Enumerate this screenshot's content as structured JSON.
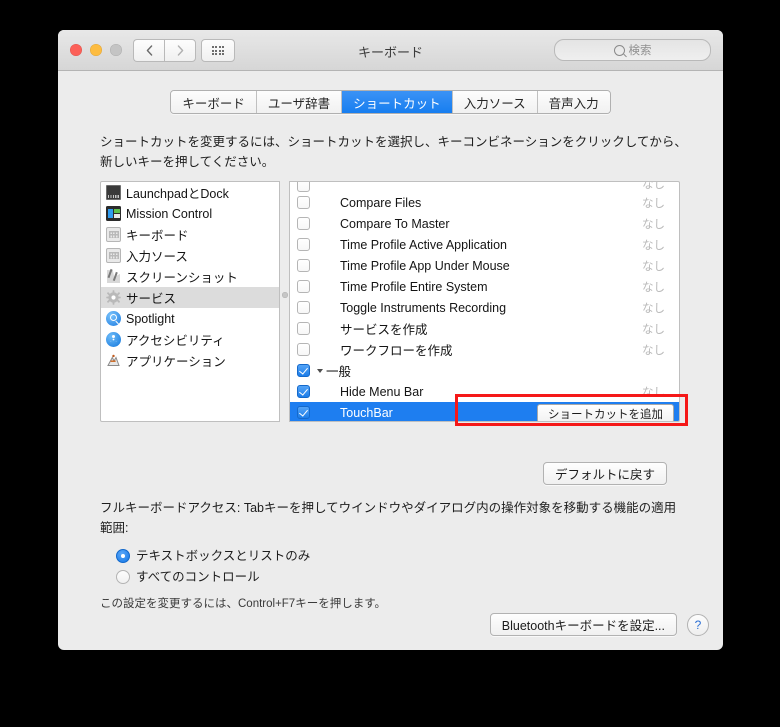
{
  "window": {
    "title": "キーボード",
    "traffic": {
      "close": "close-button",
      "minimize": "minimize-button",
      "zoom": "zoom-button"
    },
    "nav": {
      "back": "‹",
      "forward": "›"
    },
    "search": {
      "placeholder": "検索",
      "value": ""
    }
  },
  "tabs": [
    {
      "label": "キーボード",
      "active": false
    },
    {
      "label": "ユーザ辞書",
      "active": false
    },
    {
      "label": "ショートカット",
      "active": true
    },
    {
      "label": "入力ソース",
      "active": false
    },
    {
      "label": "音声入力",
      "active": false
    }
  ],
  "instruction": "ショートカットを変更するには、ショートカットを選択し、キーコンビネーションをクリックしてから、新しいキーを押してください。",
  "sidebar": {
    "items": [
      {
        "label": "LaunchpadとDock",
        "icon": "monitor-icon",
        "selected": false
      },
      {
        "label": "Mission Control",
        "icon": "mission-control-icon",
        "selected": false
      },
      {
        "label": "キーボード",
        "icon": "keyboard-icon",
        "selected": false
      },
      {
        "label": "入力ソース",
        "icon": "keyboard-icon",
        "selected": false
      },
      {
        "label": "スクリーンショット",
        "icon": "screenshot-icon",
        "selected": false
      },
      {
        "label": "サービス",
        "icon": "gear-icon",
        "selected": true
      },
      {
        "label": "Spotlight",
        "icon": "spotlight-icon",
        "selected": false
      },
      {
        "label": "アクセシビリティ",
        "icon": "accessibility-icon",
        "selected": false
      },
      {
        "label": "アプリケーション",
        "icon": "automator-icon",
        "selected": false
      }
    ]
  },
  "shortcut_list": {
    "key_column_none": "なし",
    "add_shortcut_label": "ショートカットを追加",
    "rows": [
      {
        "label": "",
        "checked": false,
        "key": "なし",
        "selected": false,
        "group": false,
        "clipped": true
      },
      {
        "label": "Compare Files",
        "checked": false,
        "key": "なし",
        "selected": false,
        "group": false,
        "clipped": false
      },
      {
        "label": "Compare To Master",
        "checked": false,
        "key": "なし",
        "selected": false,
        "group": false,
        "clipped": false
      },
      {
        "label": "Time Profile Active Application",
        "checked": false,
        "key": "なし",
        "selected": false,
        "group": false,
        "clipped": false
      },
      {
        "label": "Time Profile App Under Mouse",
        "checked": false,
        "key": "なし",
        "selected": false,
        "group": false,
        "clipped": false
      },
      {
        "label": "Time Profile Entire System",
        "checked": false,
        "key": "なし",
        "selected": false,
        "group": false,
        "clipped": false
      },
      {
        "label": "Toggle Instruments Recording",
        "checked": false,
        "key": "なし",
        "selected": false,
        "group": false,
        "clipped": false
      },
      {
        "label": "サービスを作成",
        "checked": false,
        "key": "なし",
        "selected": false,
        "group": false,
        "clipped": false
      },
      {
        "label": "ワークフローを作成",
        "checked": false,
        "key": "なし",
        "selected": false,
        "group": false,
        "clipped": false
      },
      {
        "label": "一般",
        "checked": true,
        "key": "",
        "selected": false,
        "group": true,
        "clipped": false
      },
      {
        "label": "Hide Menu Bar",
        "checked": true,
        "key": "なし",
        "selected": false,
        "group": false,
        "clipped": false
      },
      {
        "label": "TouchBar",
        "checked": true,
        "key": "",
        "selected": true,
        "group": false,
        "clipped": false,
        "has_add_button": true
      }
    ]
  },
  "restore_button": "デフォルトに戻す",
  "full_keyboard_access": {
    "description": "フルキーボードアクセス: Tabキーを押してウインドウやダイアログ内の操作対象を移動する機能の適用範囲:",
    "options": [
      {
        "label": "テキストボックスとリストのみ",
        "selected": true
      },
      {
        "label": "すべてのコントロール",
        "selected": false
      }
    ],
    "note": "この設定を変更するには、Control+F7キーを押します。"
  },
  "bottom": {
    "bluetooth_button": "Bluetoothキーボードを設定...",
    "help_button": "?"
  },
  "colors": {
    "accent_blue": "#1e7ef0",
    "annotation_red": "#f51818",
    "window_bg": "#ececec",
    "selected_sidebar": "#dcdcdc"
  }
}
